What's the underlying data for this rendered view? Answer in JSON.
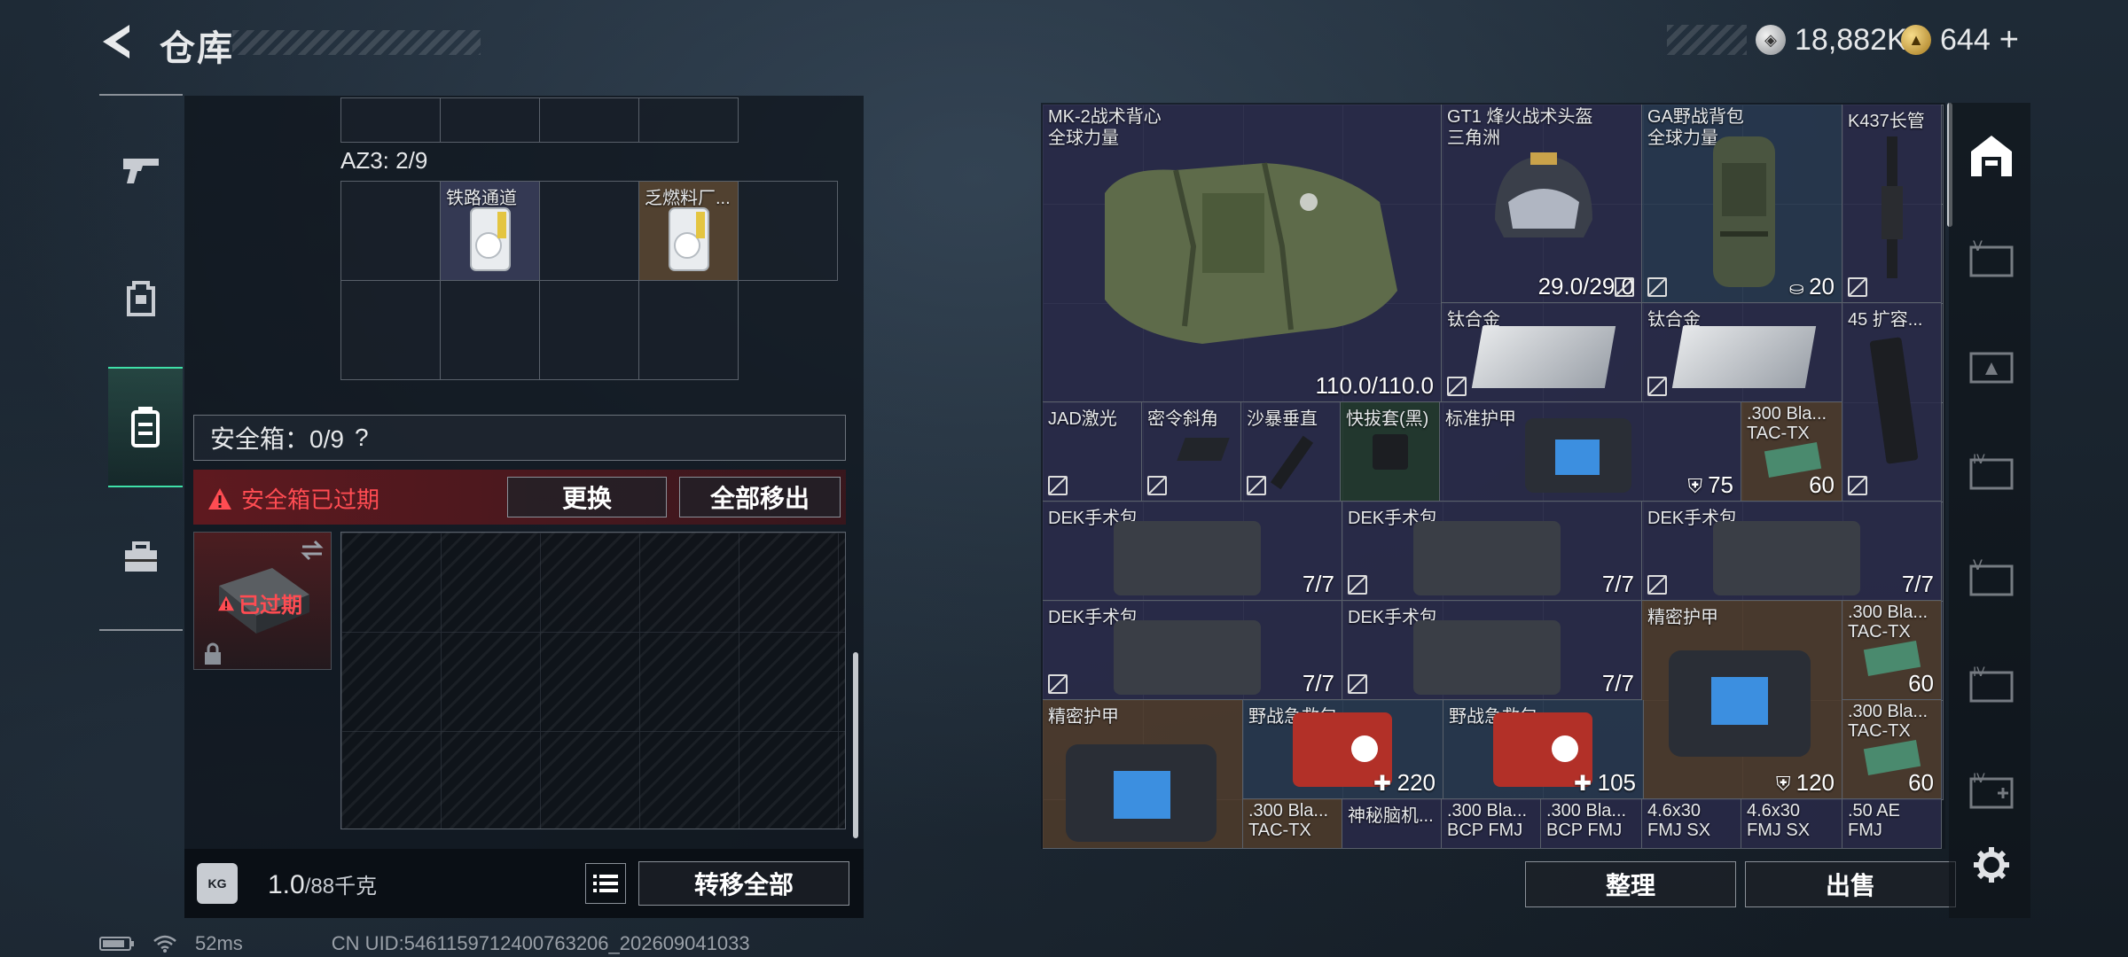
{
  "header": {
    "title": "仓库",
    "currency_silver": "18,882K",
    "currency_gold": "644",
    "add_symbol": "+"
  },
  "left_panel": {
    "az3_label": "AZ3: 2/9",
    "az3_items": [
      {
        "name": "铁路通道"
      },
      {
        "name": "乏燃料厂..."
      }
    ],
    "safe_label": "安全箱：0/9",
    "safe_help": "?",
    "alert_text": "安全箱已过期",
    "replace_button": "更换",
    "move_all_button": "全部移出",
    "expired_badge": "已过期",
    "weight_value": "1.0",
    "weight_unit": "/88千克",
    "transfer_all_button": "转移全部"
  },
  "right_panel": {
    "items": [
      {
        "name": "MK-2战术背心",
        "sub": "全球力量",
        "value": "110.0/110.0"
      },
      {
        "name": "GT1 烽火战术头盔",
        "sub": "三角洲",
        "value": "29.0/29.0"
      },
      {
        "name": "GA野战背包",
        "sub": "全球力量",
        "value": "20"
      },
      {
        "name": "K437长管",
        "sub": "",
        "value": ""
      },
      {
        "name": "钛合金",
        "value": ""
      },
      {
        "name": "钛合金",
        "value": ""
      },
      {
        "name": "45 扩容...",
        "value": ""
      },
      {
        "name": "JAD激光",
        "value": ""
      },
      {
        "name": "密令斜角",
        "value": ""
      },
      {
        "name": "沙暴垂直",
        "value": ""
      },
      {
        "name": "快拔套(黑)",
        "value": ""
      },
      {
        "name": "标准护甲",
        "value": "75"
      },
      {
        "name": ".300 Bla...",
        "sub": "TAC-TX",
        "value": "60"
      },
      {
        "name": "DEK手术包",
        "value": "7/7"
      },
      {
        "name": "DEK手术包",
        "value": "7/7"
      },
      {
        "name": "DEK手术包",
        "value": "7/7"
      },
      {
        "name": "DEK手术包",
        "value": "7/7"
      },
      {
        "name": "DEK手术包",
        "value": "7/7"
      },
      {
        "name": "精密护甲",
        "value": "120"
      },
      {
        "name": ".300 Bla...",
        "sub": "TAC-TX",
        "value": "60"
      },
      {
        "name": "精密护甲",
        "value": ""
      },
      {
        "name": "野战急救包",
        "value": "220"
      },
      {
        "name": "野战急救包",
        "value": "105"
      },
      {
        "name": ".300 Bla...",
        "sub": "TAC-TX",
        "value": "60"
      },
      {
        "name": ".300 Bla...",
        "sub": "TAC-TX",
        "value": ""
      },
      {
        "name": "神秘脑机...",
        "value": ""
      },
      {
        "name": ".300 Bla...",
        "sub": "BCP FMJ",
        "value": ""
      },
      {
        "name": ".300 Bla...",
        "sub": "BCP FMJ",
        "value": ""
      },
      {
        "name": "4.6x30",
        "sub": "FMJ SX",
        "value": ""
      },
      {
        "name": "4.6x30",
        "sub": "FMJ SX",
        "value": ""
      },
      {
        "name": ".50 AE",
        "sub": "FMJ",
        "value": ""
      }
    ],
    "sort_button": "整理",
    "sell_button": "出售"
  },
  "status": {
    "ping": "52ms",
    "uid": "CN UID:5461159712400763206_202609041033"
  },
  "colors": {
    "accent_green": "#3fe0a8",
    "alert_red": "#e2353c",
    "purple_bg": "#2a2c4a",
    "gold_bg": "#4e3c2c"
  }
}
